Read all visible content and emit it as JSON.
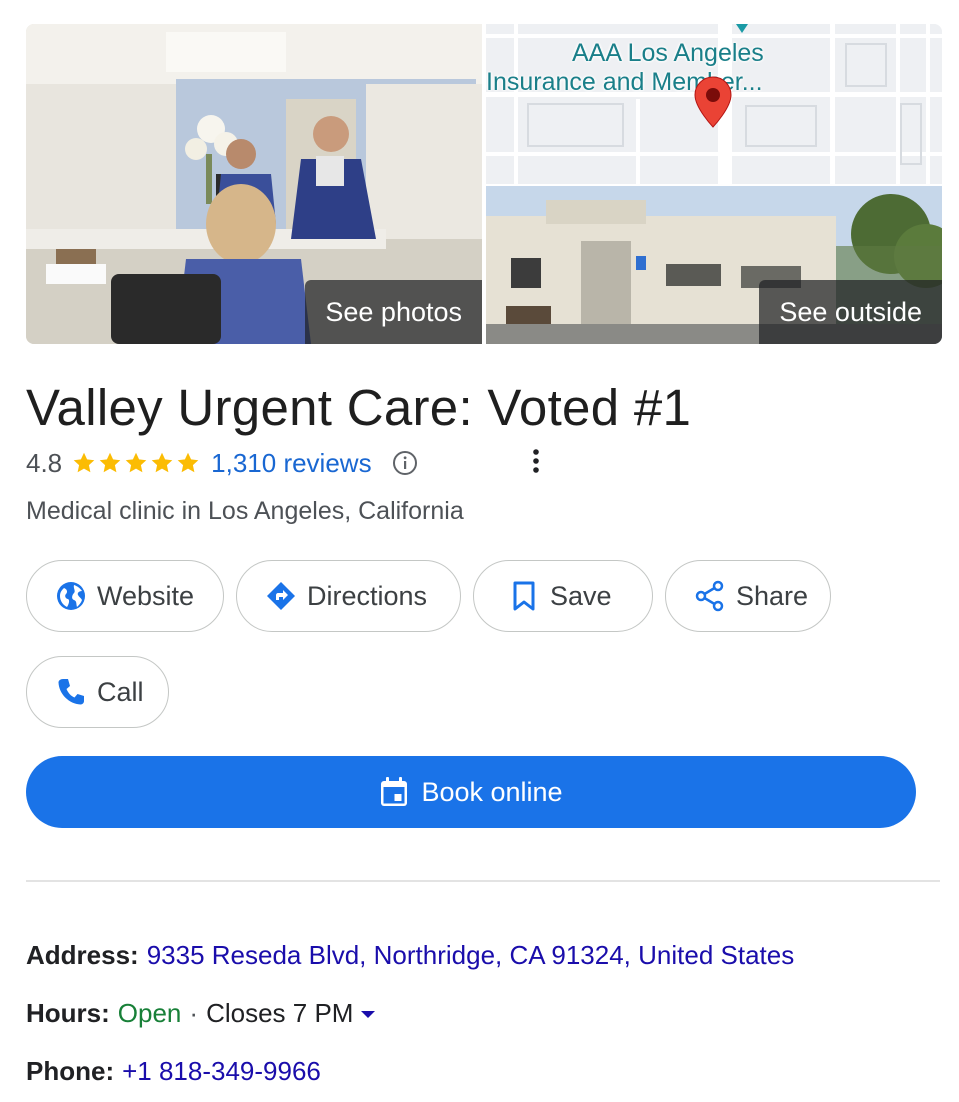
{
  "photos": {
    "see_photos_label": "See photos",
    "see_outside_label": "See outside",
    "map_label_line1": "AAA Los Angeles",
    "map_label_line2": "Insurance and Member..."
  },
  "place": {
    "name": "Valley Urgent Care: Voted #1",
    "rating": "4.8",
    "stars_filled": 5,
    "reviews_label": "1,310 reviews",
    "category": "Medical clinic in Los Angeles, California"
  },
  "actions": {
    "website": "Website",
    "directions": "Directions",
    "save": "Save",
    "share": "Share",
    "call": "Call",
    "book": "Book online"
  },
  "details": {
    "address_label": "Address:",
    "address_value": "9335 Reseda Blvd, Northridge, CA 91324, United States",
    "hours_label": "Hours:",
    "hours_status": "Open",
    "hours_separator": "·",
    "hours_close": "Closes 7 PM",
    "phone_label": "Phone:",
    "phone_value": "+1 818-349-9966"
  },
  "icons": {
    "website": "globe-icon",
    "directions": "directions-icon",
    "save": "bookmark-icon",
    "share": "share-icon",
    "call": "phone-icon",
    "book": "calendar-icon",
    "info": "info-icon",
    "more": "more-vert-icon",
    "pin": "map-pin-icon",
    "hours_toggle": "caret-down-icon"
  },
  "colors": {
    "accent": "#1a73e8",
    "link": "#1a0dab",
    "reviews_link": "#1967d2",
    "open": "#188038",
    "star": "#fbbc04",
    "pin": "#ea4335",
    "map_label": "#1a7f89"
  }
}
